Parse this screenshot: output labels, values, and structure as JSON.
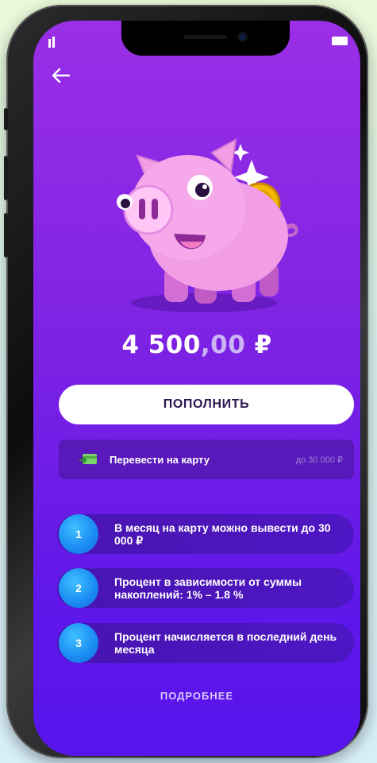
{
  "balance": {
    "integer": "4 500",
    "decimal": ",00",
    "currency": "₽"
  },
  "topup_button": {
    "label": "ПОПОЛНИТЬ"
  },
  "transfer": {
    "label": "Перевести на карту",
    "limit": "до 30 000 ₽"
  },
  "info_items": [
    {
      "number": "1",
      "text": "В месяц на карту можно вывести до 30 000 ₽"
    },
    {
      "number": "2",
      "text": "Процент в зависимости от суммы накоплений: 1% – 1.8 %"
    },
    {
      "number": "3",
      "text": "Процент начисляется в последний день месяца"
    }
  ],
  "more_link": {
    "label": "ПОДРОБНЕЕ"
  },
  "colors": {
    "background_top": "#9a2fe6",
    "background_bottom": "#5814ec",
    "accent_blue": "#1d8ef4",
    "pig_pink": "#f29ee6",
    "coin_gold": "#f5b800"
  },
  "icons": {
    "back": "arrow-left-icon",
    "card": "card-icon",
    "sparkle": "sparkle-icon",
    "coin": "percent-coin-icon",
    "piggy": "piggy-bank-illustration"
  }
}
